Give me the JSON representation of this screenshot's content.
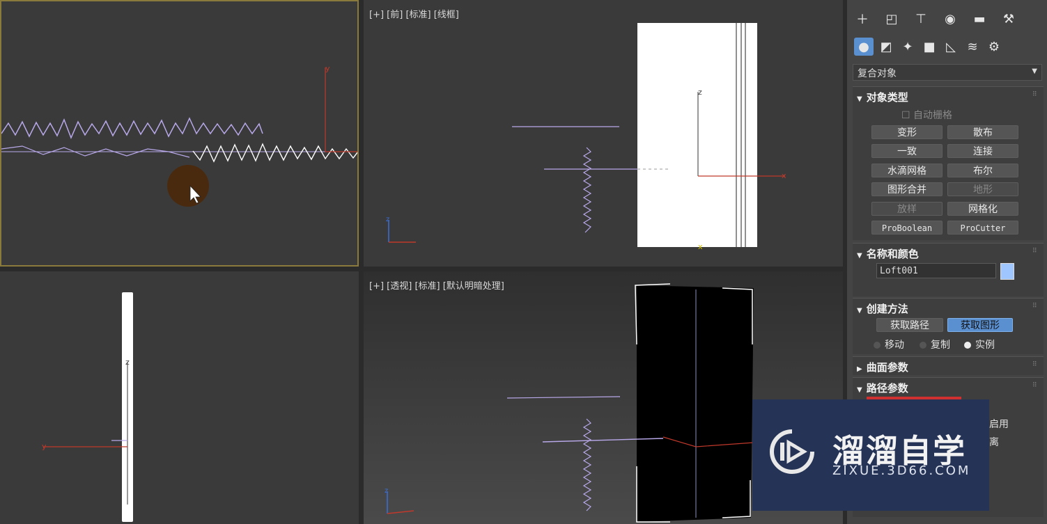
{
  "viewports": {
    "front_label": "[+] [前] [标准] [线框]",
    "persp_label": "[+] [透视] [标准] [默认明暗处理]",
    "axes": {
      "x": "x",
      "y": "y",
      "z": "z"
    }
  },
  "panel": {
    "tabs": [
      "create-icon",
      "modify-icon",
      "hierarchy-icon",
      "motion-icon",
      "display-icon",
      "utilities-icon"
    ],
    "subtabs": [
      "geometry-icon",
      "shapes-icon",
      "lights-icon",
      "cameras-icon",
      "helpers-icon",
      "spacewarps-icon",
      "systems-icon"
    ],
    "category": "复合对象",
    "object_type": {
      "title": "对象类型",
      "autogrid": "自动栅格",
      "buttons": [
        "变形",
        "散布",
        "一致",
        "连接",
        "水滴网格",
        "布尔",
        "图形合并",
        "地形",
        "放样",
        "网格化",
        "ProBoolean",
        "ProCutter"
      ]
    },
    "name_color": {
      "title": "名称和颜色",
      "name": "Loft001",
      "color": "#9fc6ff"
    },
    "creation": {
      "title": "创建方法",
      "get_path": "获取路径",
      "get_shape": "获取图形",
      "move": "移动",
      "copy": "复制",
      "instance": "实例"
    },
    "surface_params": {
      "title": "曲面参数"
    },
    "path_params": {
      "title": "路径参数",
      "partial1": "启用",
      "partial2": "离"
    }
  },
  "watermark": {
    "title": "溜溜自学",
    "subtitle": "ZIXUE.3D66.COM"
  },
  "colors": {
    "accent": "#5a8fd0",
    "viewport_border": "#8a7a3c",
    "wave": "#b9a9ea",
    "axis_red": "#c0392b"
  }
}
